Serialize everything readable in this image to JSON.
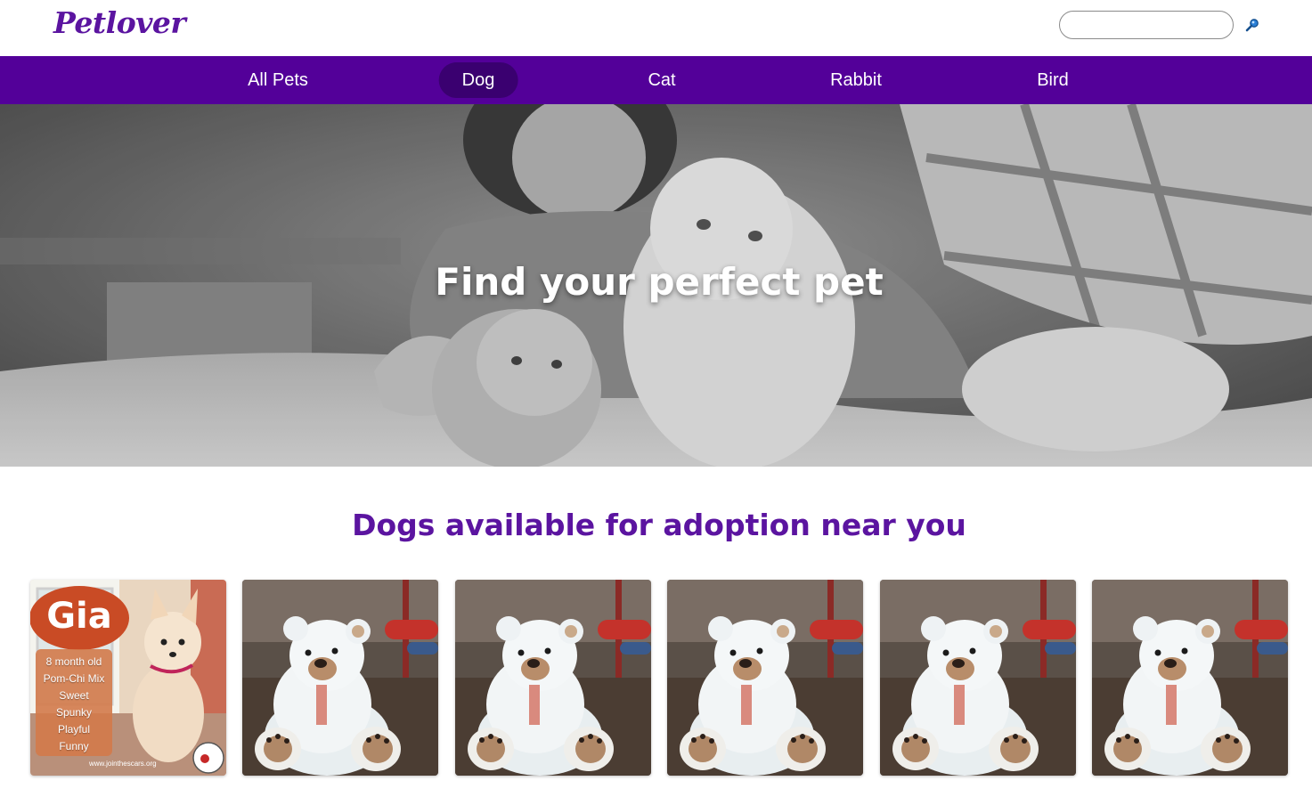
{
  "header": {
    "logo": "Petlover",
    "search": {
      "value": "",
      "placeholder": ""
    },
    "search_icon": "magnifier-icon"
  },
  "nav": {
    "items": [
      {
        "label": "All Pets",
        "active": false
      },
      {
        "label": "Dog",
        "active": true
      },
      {
        "label": "Cat",
        "active": false
      },
      {
        "label": "Rabbit",
        "active": false
      },
      {
        "label": "Bird",
        "active": false
      }
    ]
  },
  "hero": {
    "title": "Find your perfect pet"
  },
  "section": {
    "title": "Dogs available for adoption near you"
  },
  "cards": [
    {
      "name": "Gia",
      "lines": [
        "8 month old",
        "Pom-Chi Mix",
        "Sweet",
        "Spunky",
        "Playful",
        "Funny"
      ],
      "url": "www.jointhescars.org"
    },
    {
      "image": "teddy-bear"
    },
    {
      "image": "teddy-bear"
    },
    {
      "image": "teddy-bear"
    },
    {
      "image": "teddy-bear"
    },
    {
      "image": "teddy-bear"
    }
  ],
  "colors": {
    "brand": "#5b14a0",
    "nav_bg": "#530099",
    "nav_active": "#3a0070"
  }
}
